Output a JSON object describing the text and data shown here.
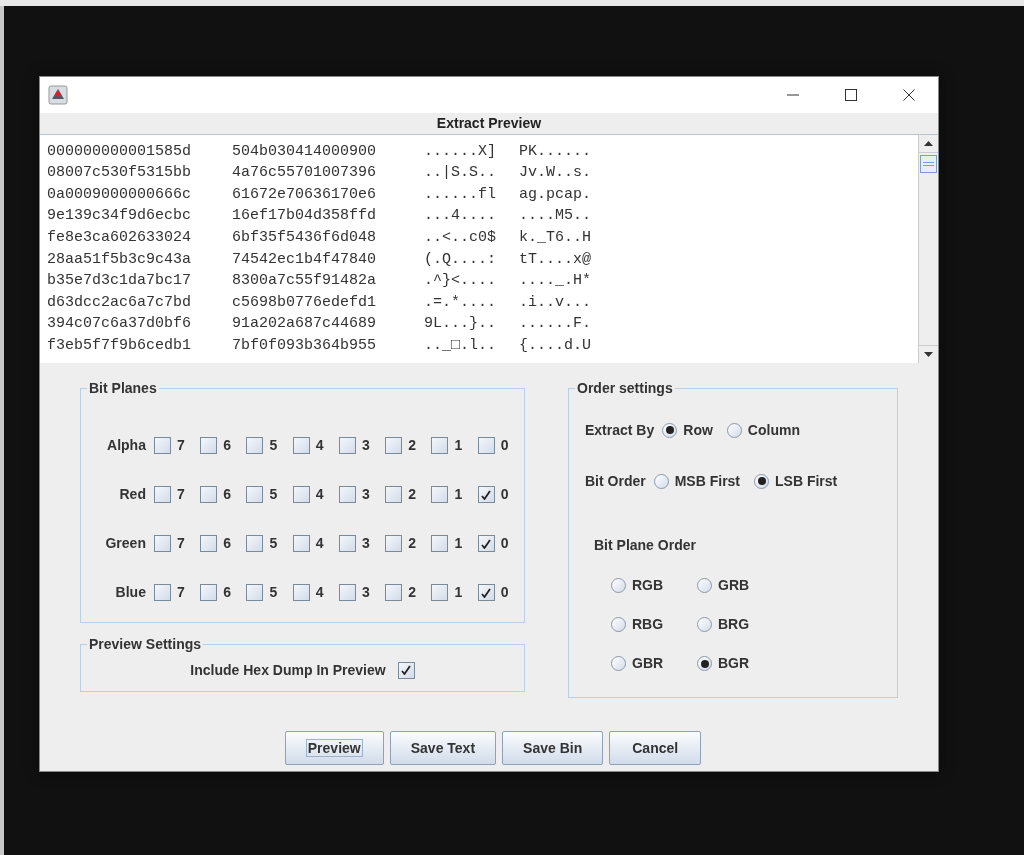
{
  "window": {
    "title": "Extract Preview"
  },
  "preview_rows": [
    {
      "hex_1": "000000000001585d",
      "hex_2": "504b030414000900",
      "ascii_1": "......X]",
      "ascii_2": "PK......"
    },
    {
      "hex_1": "08007c530f5315bb",
      "hex_2": "4a76c55701007396",
      "ascii_1": "..|S.S..",
      "ascii_2": "Jv.W..s."
    },
    {
      "hex_1": "0a0009000000666c",
      "hex_2": "61672e70636170e6",
      "ascii_1": "......fl",
      "ascii_2": "ag.pcap."
    },
    {
      "hex_1": "9e139c34f9d6ecbc",
      "hex_2": "16ef17b04d358ffd",
      "ascii_1": "...4....",
      "ascii_2": "....M5.."
    },
    {
      "hex_1": "fe8e3ca602633024",
      "hex_2": "6bf35f5436f6d048",
      "ascii_1": "..<..c0$",
      "ascii_2": "k._T6..H"
    },
    {
      "hex_1": "28aa51f5b3c9c43a",
      "hex_2": "74542ec1b4f47840",
      "ascii_1": "(.Q....:",
      "ascii_2": "tT....x@"
    },
    {
      "hex_1": "b35e7d3c1da7bc17",
      "hex_2": "8300a7c55f91482a",
      "ascii_1": ".^}<....",
      "ascii_2": "...._.H*"
    },
    {
      "hex_1": "d63dcc2ac6a7c7bd",
      "hex_2": "c5698b0776edefd1",
      "ascii_1": ".=.*....",
      "ascii_2": ".i..v..."
    },
    {
      "hex_1": "394c07c6a37d0bf6",
      "hex_2": "91a202a687c44689",
      "ascii_1": "9L...}..",
      "ascii_2": "......F."
    },
    {
      "hex_1": "f3eb5f7f9b6cedb1",
      "hex_2": "7bf0f093b364b955",
      "ascii_1": ".._□.l..",
      "ascii_2": "{....d.U"
    }
  ],
  "bit_planes": {
    "title": "Bit Planes",
    "rows": [
      {
        "label": "Alpha",
        "bits": [
          {
            "label": "7",
            "checked": false
          },
          {
            "label": "6",
            "checked": false
          },
          {
            "label": "5",
            "checked": false
          },
          {
            "label": "4",
            "checked": false
          },
          {
            "label": "3",
            "checked": false
          },
          {
            "label": "2",
            "checked": false
          },
          {
            "label": "1",
            "checked": false
          },
          {
            "label": "0",
            "checked": false
          }
        ]
      },
      {
        "label": "Red",
        "bits": [
          {
            "label": "7",
            "checked": false
          },
          {
            "label": "6",
            "checked": false
          },
          {
            "label": "5",
            "checked": false
          },
          {
            "label": "4",
            "checked": false
          },
          {
            "label": "3",
            "checked": false
          },
          {
            "label": "2",
            "checked": false
          },
          {
            "label": "1",
            "checked": false
          },
          {
            "label": "0",
            "checked": true
          }
        ]
      },
      {
        "label": "Green",
        "bits": [
          {
            "label": "7",
            "checked": false
          },
          {
            "label": "6",
            "checked": false
          },
          {
            "label": "5",
            "checked": false
          },
          {
            "label": "4",
            "checked": false
          },
          {
            "label": "3",
            "checked": false
          },
          {
            "label": "2",
            "checked": false
          },
          {
            "label": "1",
            "checked": false
          },
          {
            "label": "0",
            "checked": true
          }
        ]
      },
      {
        "label": "Blue",
        "bits": [
          {
            "label": "7",
            "checked": false
          },
          {
            "label": "6",
            "checked": false
          },
          {
            "label": "5",
            "checked": false
          },
          {
            "label": "4",
            "checked": false
          },
          {
            "label": "3",
            "checked": false
          },
          {
            "label": "2",
            "checked": false
          },
          {
            "label": "1",
            "checked": false
          },
          {
            "label": "0",
            "checked": true
          }
        ]
      }
    ]
  },
  "preview_settings": {
    "title": "Preview Settings",
    "option": {
      "label": "Include Hex Dump In Preview",
      "checked": true
    }
  },
  "order_settings": {
    "title": "Order settings",
    "extract_by": {
      "label": "Extract By",
      "options": [
        {
          "label": "Row",
          "selected": true
        },
        {
          "label": "Column",
          "selected": false
        }
      ]
    },
    "bit_order": {
      "label": "Bit Order",
      "options": [
        {
          "label": "MSB First",
          "selected": false
        },
        {
          "label": "LSB First",
          "selected": true
        }
      ]
    },
    "bit_plane_order": {
      "label": "Bit Plane Order",
      "options": [
        {
          "label": "RGB",
          "selected": false
        },
        {
          "label": "GRB",
          "selected": false
        },
        {
          "label": "RBG",
          "selected": false
        },
        {
          "label": "BRG",
          "selected": false
        },
        {
          "label": "GBR",
          "selected": false
        },
        {
          "label": "BGR",
          "selected": true
        }
      ]
    }
  },
  "buttons": [
    {
      "label": "Preview",
      "focused": true
    },
    {
      "label": "Save Text",
      "focused": false
    },
    {
      "label": "Save Bin",
      "focused": false
    },
    {
      "label": "Cancel",
      "focused": false
    }
  ]
}
